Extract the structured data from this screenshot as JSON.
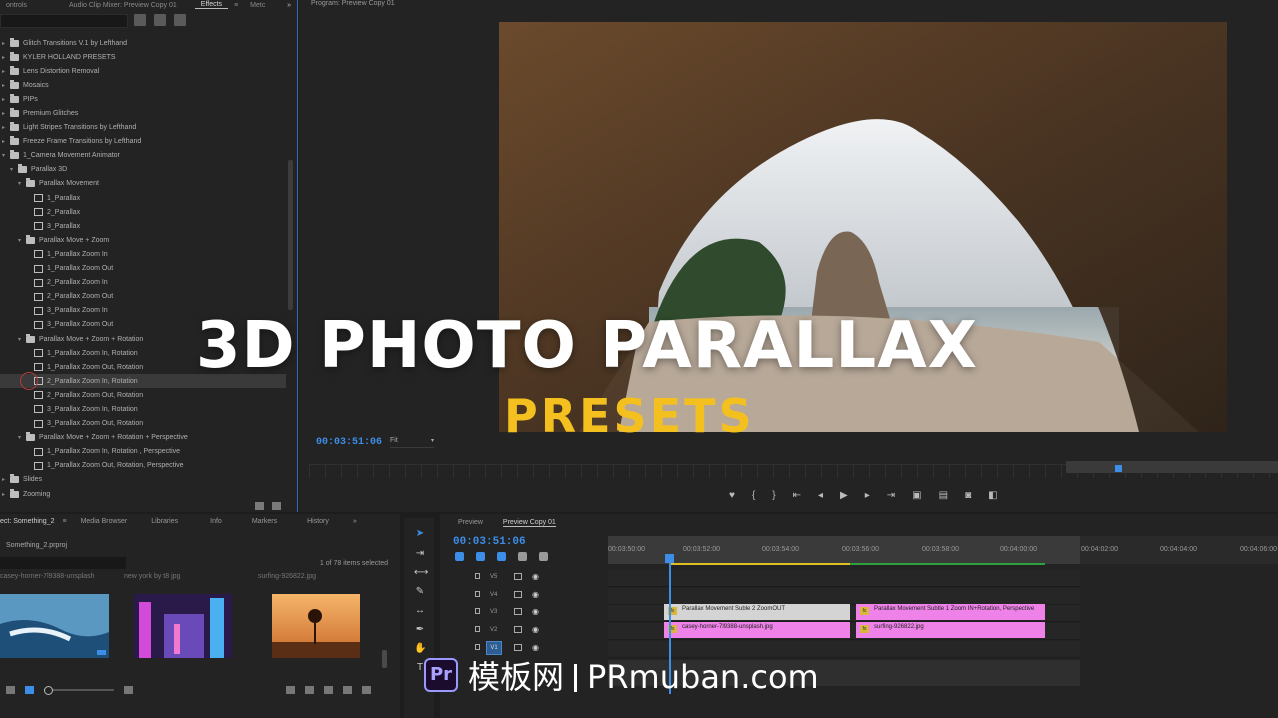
{
  "effects_panel": {
    "tabs": [
      "ontrols",
      "Audio Clip Mixer: Preview Copy 01",
      "Effects",
      "Metc"
    ],
    "active_tab": "Effects",
    "tree": [
      {
        "label": "Glitch Transitions V.1 by Lefthand",
        "level": 0,
        "kind": "folder"
      },
      {
        "label": "KYLER HOLLAND PRESETS",
        "level": 0,
        "kind": "folder"
      },
      {
        "label": "Lens Distortion Removal",
        "level": 0,
        "kind": "folder"
      },
      {
        "label": "Mosaics",
        "level": 0,
        "kind": "folder"
      },
      {
        "label": "PIPs",
        "level": 0,
        "kind": "folder"
      },
      {
        "label": "Premium Glitches",
        "level": 0,
        "kind": "folder"
      },
      {
        "label": "Light Stripes Transitions by Lefthand",
        "level": 0,
        "kind": "folder"
      },
      {
        "label": "Freeze Frame Transitions by Lefthand",
        "level": 0,
        "kind": "folder"
      },
      {
        "label": "1_Camera Movement Animator",
        "level": 0,
        "kind": "folder"
      },
      {
        "label": "Parallax 3D",
        "level": 1,
        "kind": "folder"
      },
      {
        "label": "Parallax Movement",
        "level": 2,
        "kind": "folder"
      },
      {
        "label": "1_Parallax",
        "level": 3,
        "kind": "preset"
      },
      {
        "label": "2_Parallax",
        "level": 3,
        "kind": "preset"
      },
      {
        "label": "3_Parallax",
        "level": 3,
        "kind": "preset"
      },
      {
        "label": "Parallax Move + Zoom",
        "level": 2,
        "kind": "folder"
      },
      {
        "label": "1_Parallax Zoom In",
        "level": 3,
        "kind": "preset"
      },
      {
        "label": "1_Parallax Zoom Out",
        "level": 3,
        "kind": "preset"
      },
      {
        "label": "2_Parallax Zoom In",
        "level": 3,
        "kind": "preset"
      },
      {
        "label": "2_Parallax Zoom Out",
        "level": 3,
        "kind": "preset"
      },
      {
        "label": "3_Parallax Zoom In",
        "level": 3,
        "kind": "preset"
      },
      {
        "label": "3_Parallax Zoom Out",
        "level": 3,
        "kind": "preset"
      },
      {
        "label": "Parallax Move + Zoom + Rotation",
        "level": 2,
        "kind": "folder"
      },
      {
        "label": "1_Parallax Zoom In, Rotation",
        "level": 3,
        "kind": "preset"
      },
      {
        "label": "1_Parallax Zoom Out, Rotation",
        "level": 3,
        "kind": "preset"
      },
      {
        "label": "2_Parallax Zoom In, Rotation",
        "level": 3,
        "kind": "preset",
        "selected": true
      },
      {
        "label": "2_Parallax Zoom Out, Rotation",
        "level": 3,
        "kind": "preset"
      },
      {
        "label": "3_Parallax Zoom In, Rotation",
        "level": 3,
        "kind": "preset"
      },
      {
        "label": "3_Parallax Zoom Out, Rotation",
        "level": 3,
        "kind": "preset"
      },
      {
        "label": "Parallax Move + Zoom + Rotation + Perspective",
        "level": 2,
        "kind": "folder"
      },
      {
        "label": "1_Parallax Zoom In, Rotation , Perspective",
        "level": 3,
        "kind": "preset"
      },
      {
        "label": "1_Parallax Zoom Out, Rotation, Perspective",
        "level": 3,
        "kind": "preset"
      },
      {
        "label": "Slides",
        "level": 0,
        "kind": "folder"
      },
      {
        "label": "Zooming",
        "level": 0,
        "kind": "folder"
      }
    ]
  },
  "program_monitor": {
    "title": "Program: Preview Copy 01",
    "timecode": "00:03:51:06",
    "fit": "Fit"
  },
  "overlay": {
    "title": "3D PHOTO PARALLAX",
    "subtitle": "PRESETS"
  },
  "project_panel": {
    "tabs": [
      "ect: Something_2",
      "Media Browser",
      "Libraries",
      "Info",
      "Markers",
      "History"
    ],
    "file": "Something_2.prproj",
    "items_count": "1 of 78 items selected",
    "thumb_labels": [
      "casey-horner-7l9388-unsplash",
      "new york by t8 jpg",
      "surfing-926822.jpg"
    ]
  },
  "timeline": {
    "tabs": [
      "Preview",
      "Preview Copy 01"
    ],
    "timecode": "00:03:51:06",
    "ticks": [
      "00:03:50:00",
      "00:03:52:00",
      "00:03:54:00",
      "00:03:56:00",
      "00:03:58:00",
      "00:04:00:00",
      "00:04:02:00",
      "00:04:04:00",
      "00:04:06:00"
    ],
    "tracks": [
      "V5",
      "V4",
      "V3",
      "V2",
      "V1"
    ],
    "clips": {
      "v3_a": "Parallax Movement Suble 2 ZoomOUT",
      "v3_b": "Parallax Movement Subtle 1 Zoom IN+Rotation, Perspective",
      "v2_a": "casey-horner-7l9388-unsplash.jpg",
      "v2_b": "surfing-926822.jpg"
    },
    "fx_badge": "fx"
  },
  "watermark": {
    "logo": "Pr",
    "cn": "模板网",
    "domain": "PRmuban.com"
  },
  "colors": {
    "accent_blue": "#3d8ee8",
    "subtitle_yellow": "#f4c020",
    "clip_pink": "#ee82e8",
    "adjustment_grey": "#d4d4d4"
  }
}
